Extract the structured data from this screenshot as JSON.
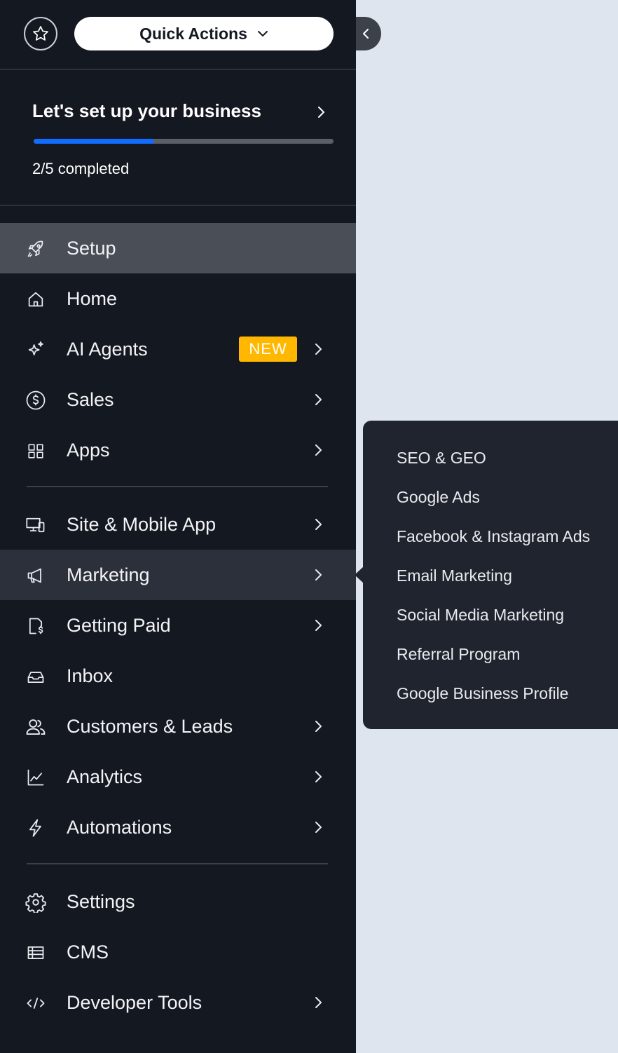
{
  "header": {
    "favorite_icon": "star-icon",
    "quick_actions_label": "Quick Actions",
    "quick_actions_icon": "chevron-down-icon"
  },
  "setup_card": {
    "title": "Let's set up your business",
    "progress_text": "2/5 completed",
    "progress_fraction": 0.4,
    "progress_color": "#116dff"
  },
  "nav": {
    "setup": "Setup",
    "home": "Home",
    "ai_agents": "AI Agents",
    "ai_agents_badge": "NEW",
    "sales": "Sales",
    "apps": "Apps",
    "site_mobile_app": "Site & Mobile App",
    "marketing": "Marketing",
    "getting_paid": "Getting Paid",
    "inbox": "Inbox",
    "customers_leads": "Customers & Leads",
    "analytics": "Analytics",
    "automations": "Automations",
    "settings": "Settings",
    "cms": "CMS",
    "developer_tools": "Developer Tools"
  },
  "marketing_flyout": {
    "items": [
      "SEO & GEO",
      "Google Ads",
      "Facebook & Instagram Ads",
      "Email Marketing",
      "Social Media Marketing",
      "Referral Program",
      "Google Business Profile"
    ]
  },
  "colors": {
    "sidebar_bg": "#141821",
    "badge_bg": "#ffb700",
    "page_bg": "#dfe5ee"
  }
}
